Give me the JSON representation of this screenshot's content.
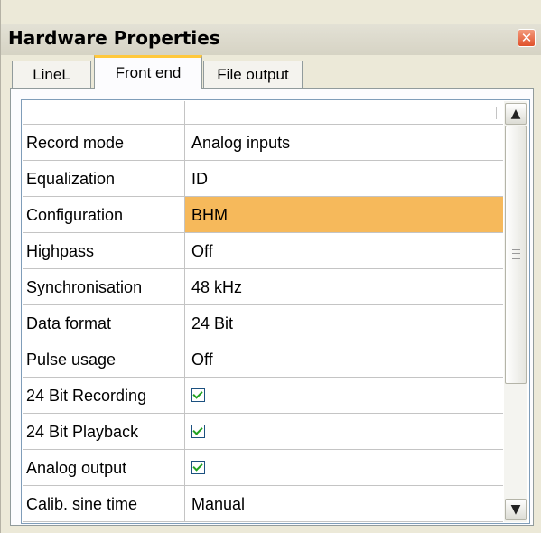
{
  "window": {
    "title": "Hardware Properties",
    "close_glyph": "✕"
  },
  "tabs": [
    {
      "label": "LineL",
      "selected": false
    },
    {
      "label": "Front end",
      "selected": true
    },
    {
      "label": "File output",
      "selected": false
    }
  ],
  "properties": [
    {
      "name": "Record mode",
      "value": "Analog inputs"
    },
    {
      "name": "Equalization",
      "value": "ID"
    },
    {
      "name": "Configuration",
      "value": "BHM",
      "selected": true
    },
    {
      "name": "Highpass",
      "value": "Off"
    },
    {
      "name": "Synchronisation",
      "value": "48 kHz"
    },
    {
      "name": "Data format",
      "value": "24 Bit"
    },
    {
      "name": "Pulse usage",
      "value": "Off"
    },
    {
      "name": "24 Bit Recording",
      "checked": true
    },
    {
      "name": "24 Bit Playback",
      "checked": true
    },
    {
      "name": "Analog output",
      "checked": true
    },
    {
      "name": "Calib. sine time",
      "value": "Manual"
    }
  ],
  "scrollbar": {
    "up_glyph": "▲",
    "down_glyph": "▼"
  },
  "colors": {
    "selected_row": "#f6b95b",
    "active_tab_accent": "#ffc83c",
    "close_button": "#e0522c"
  }
}
